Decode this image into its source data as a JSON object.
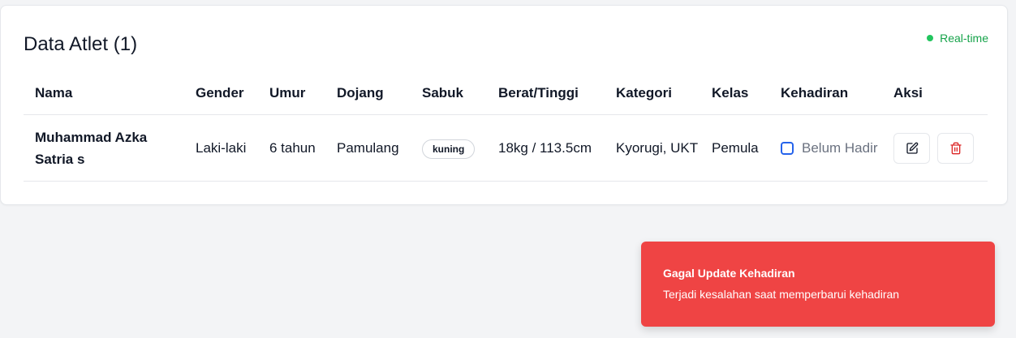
{
  "panel": {
    "title": "Data Atlet (1)",
    "status_label": "Real-time",
    "status_color": "#16a34a"
  },
  "table": {
    "headers": [
      "Nama",
      "Gender",
      "Umur",
      "Dojang",
      "Sabuk",
      "Berat/Tinggi",
      "Kategori",
      "Kelas",
      "Kehadiran",
      "Aksi"
    ],
    "rows": [
      {
        "name": "Muhammad Azka Satria s",
        "gender": "Laki-laki",
        "age": "6 tahun",
        "dojang": "Pamulang",
        "belt": "kuning",
        "weight_height": "18kg / 113.5cm",
        "category": "Kyorugi, UKT",
        "class": "Pemula",
        "attendance_label": "Belum Hadir",
        "attendance_checked": false,
        "actions": [
          "edit-icon",
          "trash-icon"
        ]
      }
    ]
  },
  "toast": {
    "title": "Gagal Update Kehadiran",
    "message": "Terjadi kesalahan saat memperbarui kehadiran",
    "color": "#ef4444"
  }
}
